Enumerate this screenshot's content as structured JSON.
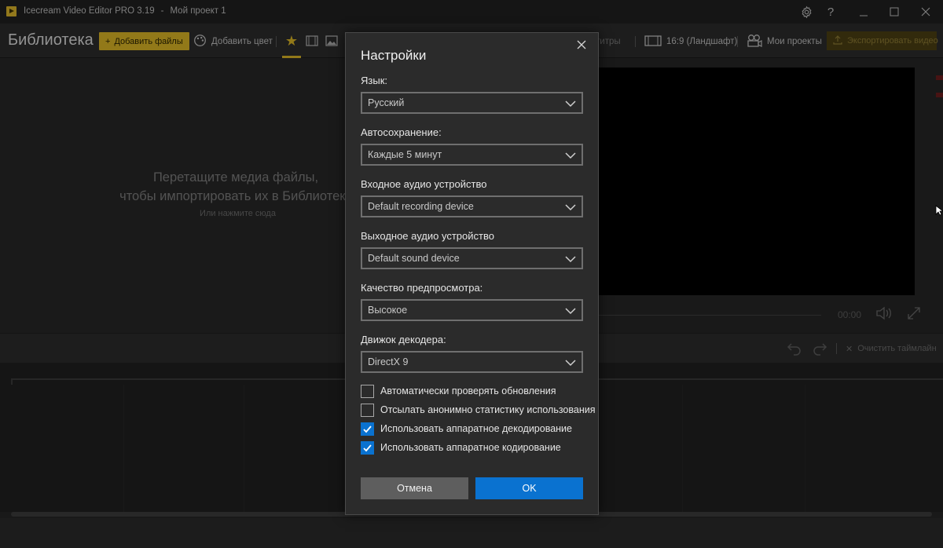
{
  "window": {
    "app_name": "Icecream Video Editor PRO 3.19",
    "separator": "-",
    "project_name": "Мой проект 1"
  },
  "toolbar": {
    "library_title": "Библиотека",
    "add_files": "Добавить файлы",
    "add_color": "Добавить цвет",
    "subtitles_fragment": "титры",
    "aspect": "16:9 (Ландшафт)",
    "my_projects": "Мои проекты",
    "export": "Экспортировать видео"
  },
  "library": {
    "drop_line1": "Перетащите медиа файлы,",
    "drop_line2": "чтобы импортировать их в Библиотеку",
    "drop_sub": "Или нажмите сюда"
  },
  "preview": {
    "timecode": "00:00"
  },
  "timeline": {
    "clear_label": "Очистить таймлайн"
  },
  "dialog": {
    "title": "Настройки",
    "fields": [
      {
        "label": "Язык:",
        "value": "Русский"
      },
      {
        "label": "Автосохранение:",
        "value": "Каждые 5 минут"
      },
      {
        "label": "Входное аудио устройство",
        "value": "Default recording device"
      },
      {
        "label": "Выходное аудио устройство",
        "value": "Default sound device"
      },
      {
        "label": "Качество предпросмотра:",
        "value": "Высокое"
      },
      {
        "label": "Движок декодера:",
        "value": "DirectX 9"
      }
    ],
    "checkboxes": [
      {
        "label": "Автоматически проверять обновления",
        "checked": false
      },
      {
        "label": "Отсылать анонимно статистику использования",
        "checked": false
      },
      {
        "label": "Использовать аппаратное декодирование",
        "checked": true
      },
      {
        "label": "Использовать аппаратное кодирование",
        "checked": true
      }
    ],
    "cancel": "Отмена",
    "ok": "OK"
  },
  "colors": {
    "accent_yellow": "#d8b325",
    "accent_blue": "#0a72d0"
  }
}
